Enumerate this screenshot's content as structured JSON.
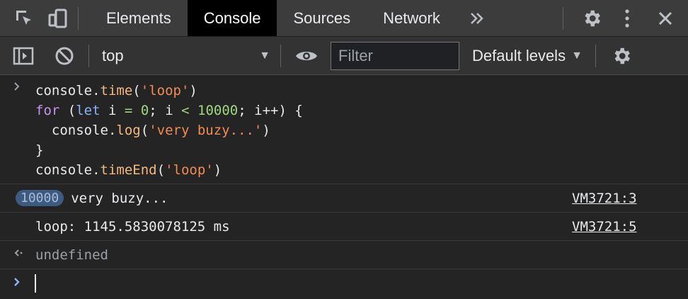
{
  "tabbar": {
    "tabs": [
      {
        "label": "Elements",
        "active": false
      },
      {
        "label": "Console",
        "active": true
      },
      {
        "label": "Sources",
        "active": false
      },
      {
        "label": "Network",
        "active": false
      }
    ],
    "overflow_icon": "double-chevron-right-icon"
  },
  "toolbar": {
    "context": "top",
    "filter_placeholder": "Filter",
    "levels": "Default levels"
  },
  "console": {
    "input_lines": [
      "console.time('loop')",
      "for (let i = 0; i < 10000; i++) {",
      "  console.log('very buzy...')",
      "}",
      "console.timeEnd('loop')"
    ],
    "messages": [
      {
        "count": "10000",
        "text": "very buzy...",
        "source": "VM3721:3"
      },
      {
        "text": "loop: 1145.5830078125 ms",
        "source": "VM3721:5"
      }
    ],
    "result": "undefined"
  },
  "colors": {
    "tabbar_bg": "#3c3c3c",
    "console_bg": "#242424",
    "active_tab_bg": "#000000",
    "prompt_blue": "#8ab4f8"
  }
}
